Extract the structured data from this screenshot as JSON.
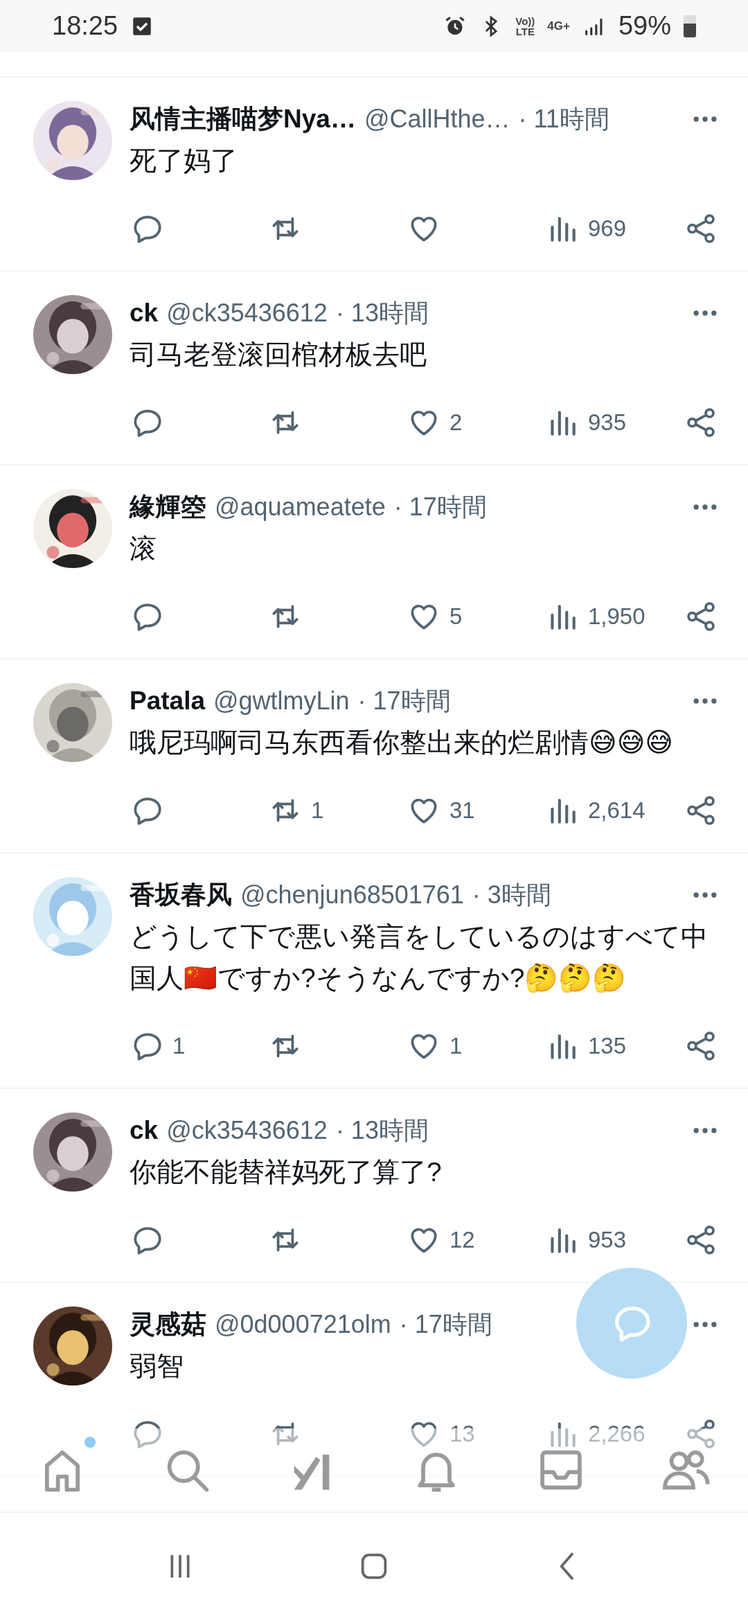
{
  "status_bar": {
    "time": "18:25",
    "volte_top": "Vo))",
    "volte_bottom": "LTE",
    "network": "4G+",
    "battery": "59%"
  },
  "tweets": [
    {
      "name": "风情主播喵梦Nya…",
      "handle": "@CallHthe…",
      "time": "· 11時間",
      "text": "死了妈了",
      "views": "969"
    },
    {
      "name": "ck",
      "handle": "@ck35436612",
      "time": "· 13時間",
      "text": "司马老登滚回棺材板去吧",
      "likes": "2",
      "views": "935"
    },
    {
      "name": "緣輝箜",
      "handle": "@aquameatete",
      "time": "· 17時間",
      "text": "滚",
      "likes": "5",
      "views": "1,950"
    },
    {
      "name": "Patala",
      "handle": "@gwtlmyLin",
      "time": "· 17時間",
      "text": "哦尼玛啊司马东西看你整出来的烂剧情😅😅😅",
      "retweets": "1",
      "likes": "31",
      "views": "2,614"
    },
    {
      "name": "香坂春风",
      "handle": "@chenjun68501761",
      "time": "· 3時間",
      "text": "どうして下で悪い発言をしているのはすべて中国人🇨🇳ですか?そうなんですか?🤔🤔🤔",
      "replies": "1",
      "likes": "1",
      "views": "135"
    },
    {
      "name": "ck",
      "handle": "@ck35436612",
      "time": "· 13時間",
      "text": "你能不能替祥妈死了算了?",
      "likes": "12",
      "views": "953"
    },
    {
      "name": "灵感菇",
      "handle": "@0d000721olm",
      "time": "· 17時間",
      "text": "弱智",
      "likes": "13",
      "views": "2,266"
    }
  ],
  "bottom_nav": [
    {
      "kind": "home",
      "badge": true
    },
    {
      "kind": "search",
      "badge": false
    },
    {
      "kind": "grok",
      "badge": false
    },
    {
      "kind": "bell",
      "badge": false
    },
    {
      "kind": "inbox",
      "badge": false
    },
    {
      "kind": "people",
      "badge": false
    }
  ]
}
